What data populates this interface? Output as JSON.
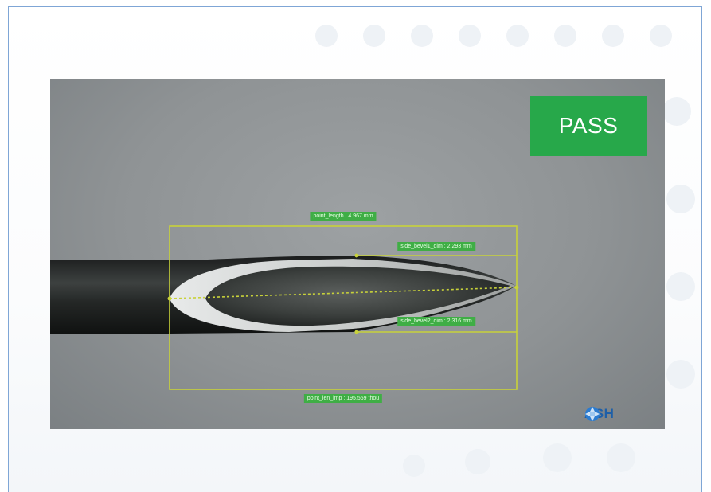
{
  "inspection": {
    "result": "PASS",
    "result_color": "#27a84a",
    "measurement_color": "#c8d23a",
    "label_color": "#3fae45",
    "measurements": {
      "point_length": "point_length : 4.967 mm",
      "side_bevel1": "side_bevel1_dim : 2.293 mm",
      "side_bevel2": "side_bevel2_dim : 2.316 mm",
      "point_len_imp": "point_len_imp : 195.559 thou"
    }
  },
  "brand": {
    "logo_text": "ASH",
    "logo_color": "#1e5fa8",
    "logo_icon": "ash-logo-icon"
  }
}
